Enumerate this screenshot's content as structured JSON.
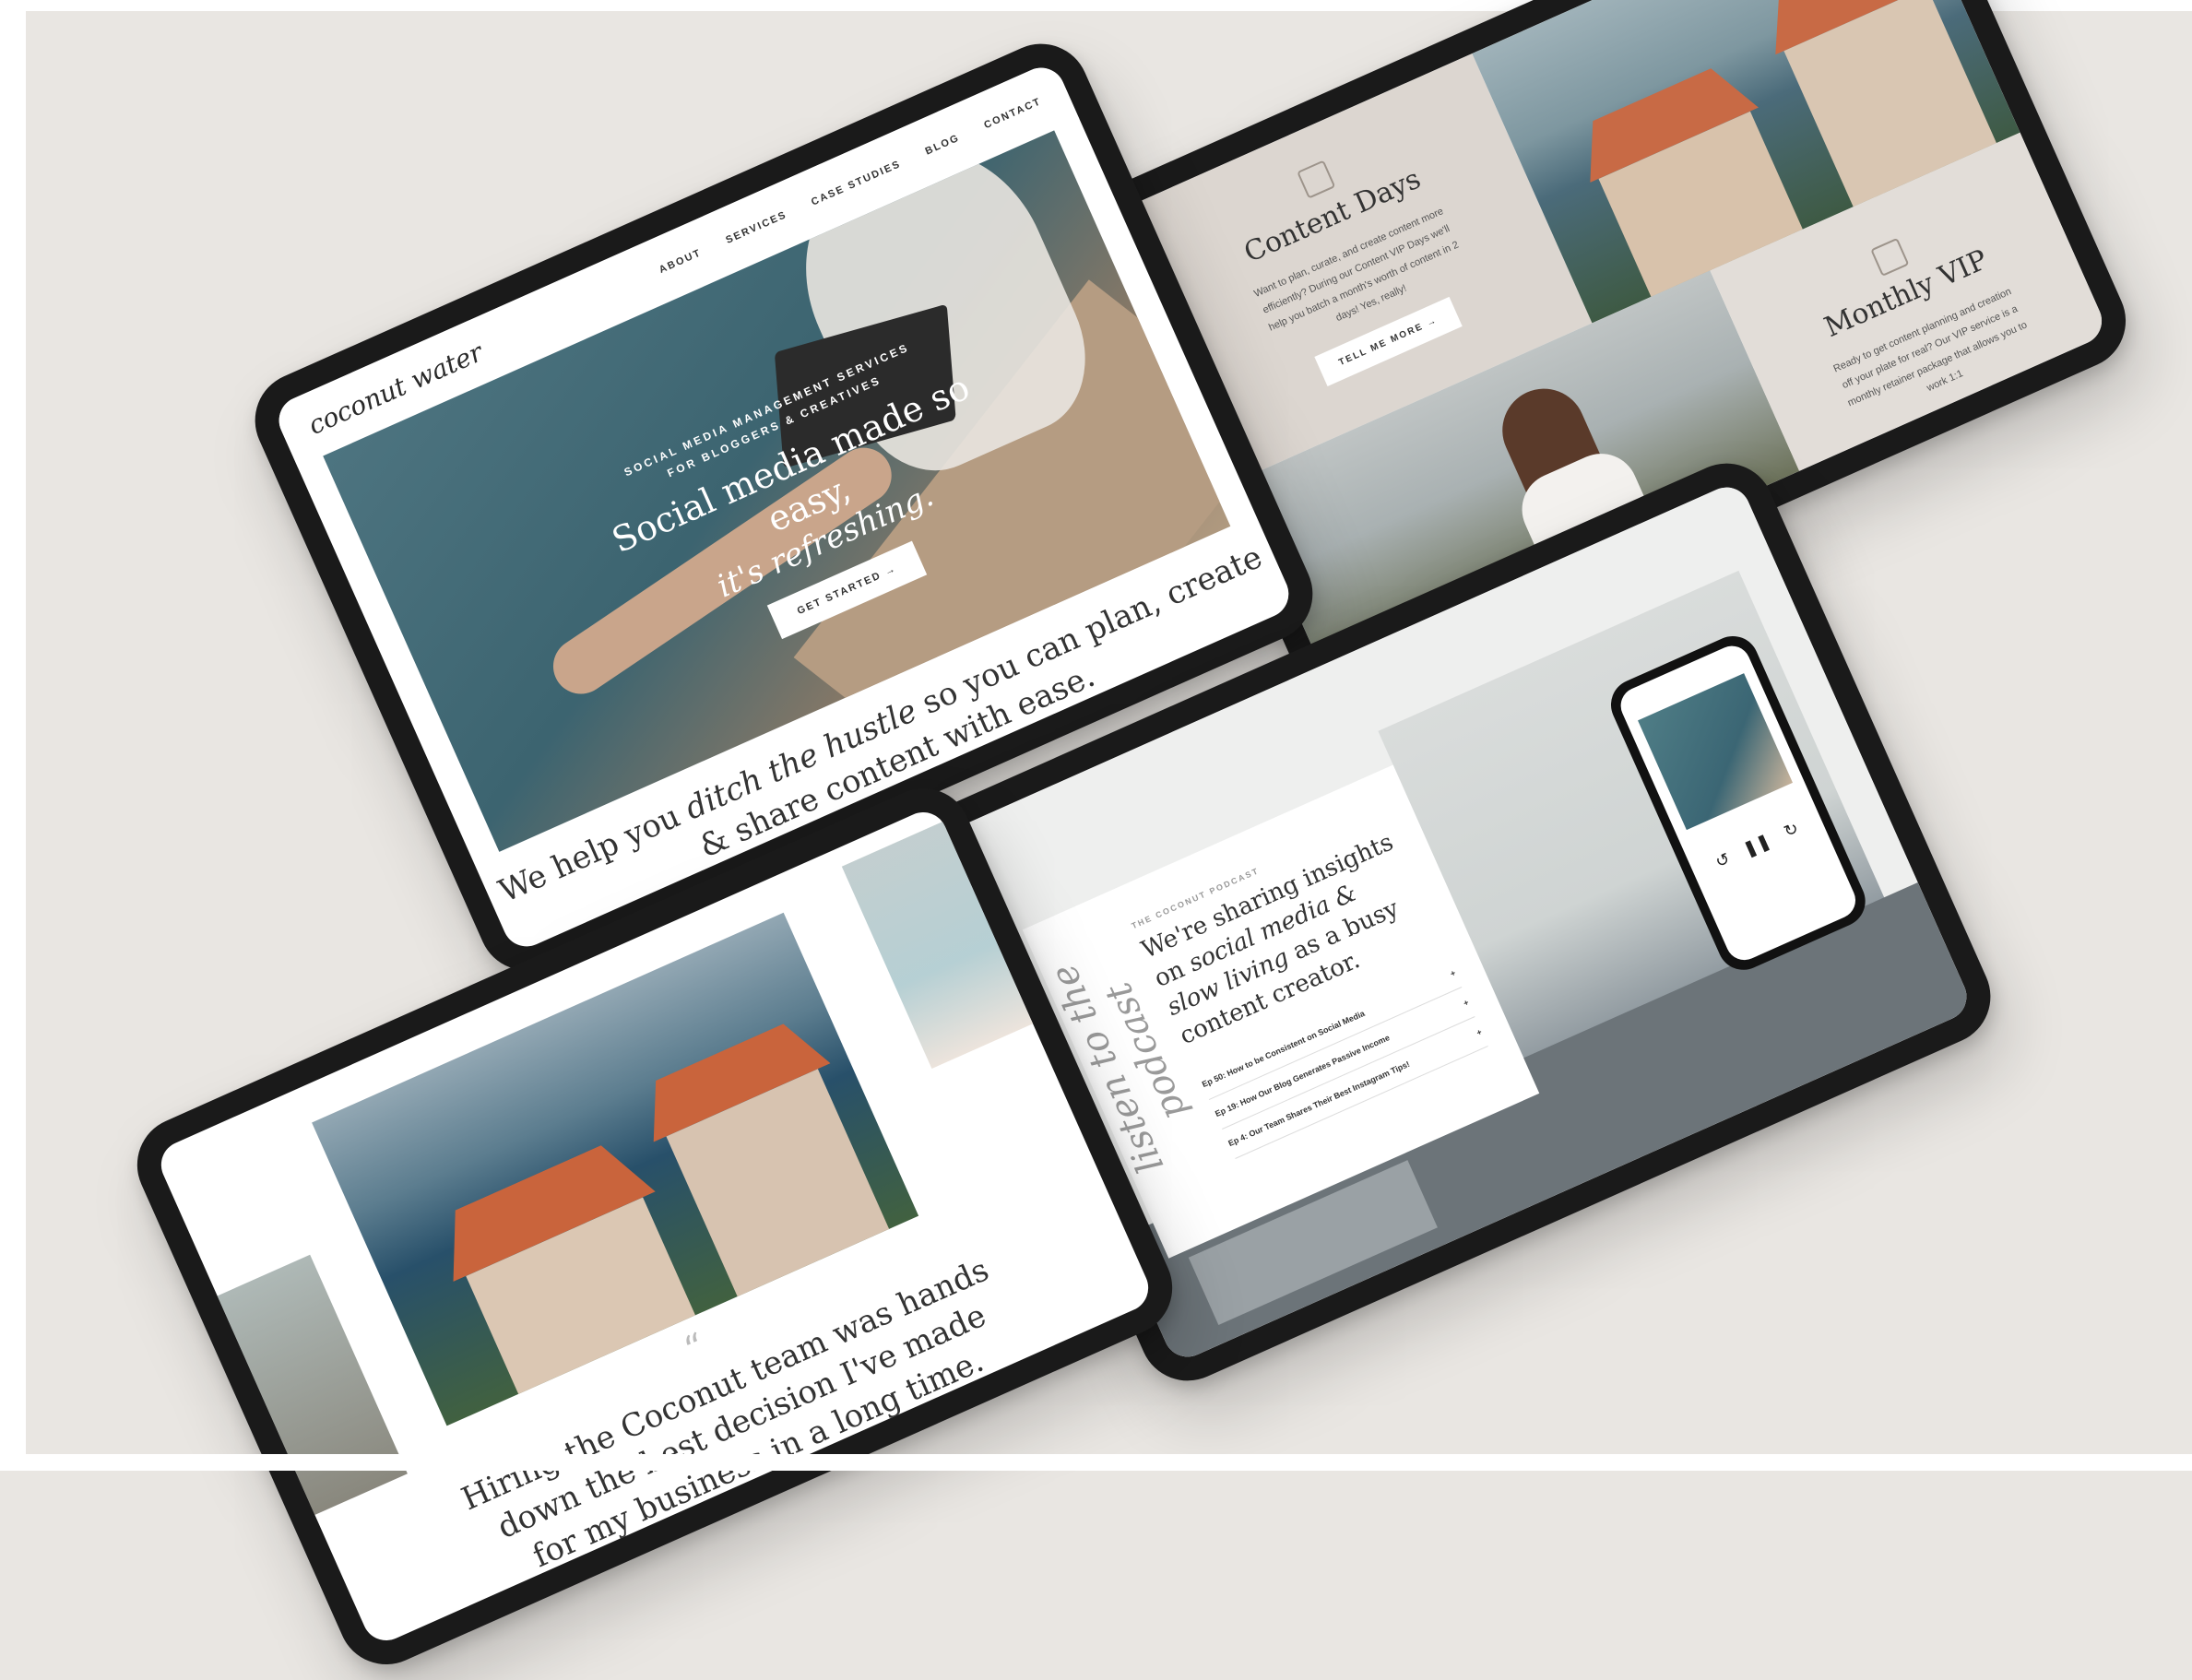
{
  "tablet1": {
    "logo": "coconut water",
    "nav": [
      "ABOUT",
      "SERVICES",
      "CASE STUDIES",
      "BLOG",
      "CONTACT"
    ],
    "eyebrow_line1": "SOCIAL MEDIA MANAGEMENT SERVICES",
    "eyebrow_line2": "FOR BLOGGERS & CREATIVES",
    "headline": "Social media made so easy,",
    "subheadline": "it's refreshing.",
    "cta": "GET STARTED →",
    "tagline_pre": "We help you ",
    "tagline_em": "ditch the hustle",
    "tagline_post": " so you can plan, create & share content with ease."
  },
  "tablet2": {
    "left_title": "Content Days",
    "left_desc": "Want to plan, curate, and create content more efficiently? During our Content VIP Days we'll help you batch a month's worth of content in 2 days! Yes, really!",
    "left_button": "TELL ME MORE →",
    "right_title": "Monthly VIP",
    "right_desc": "Ready to get content planning and creation off your plate for real? Our VIP service is a monthly retainer package that allows you to work 1:1"
  },
  "tablet3": {
    "quote_mark": "“",
    "quote": "Hiring the Coconut team was hands down the best decision I've made for my business in a long time."
  },
  "tablet4": {
    "vertical": "listen to the podcast",
    "eyebrow": "THE COCONUT PODCAST",
    "head_pre": "We're sharing insights on ",
    "head_em": "social media & slow living",
    "head_post": " as a busy content creator.",
    "episodes": [
      "Ep 50: How to be Consistent on Social Media",
      "Ep 19: How Our Blog Generates Passive Income",
      "Ep 4: Our Team Shares Their Best Instagram Tips!"
    ]
  }
}
